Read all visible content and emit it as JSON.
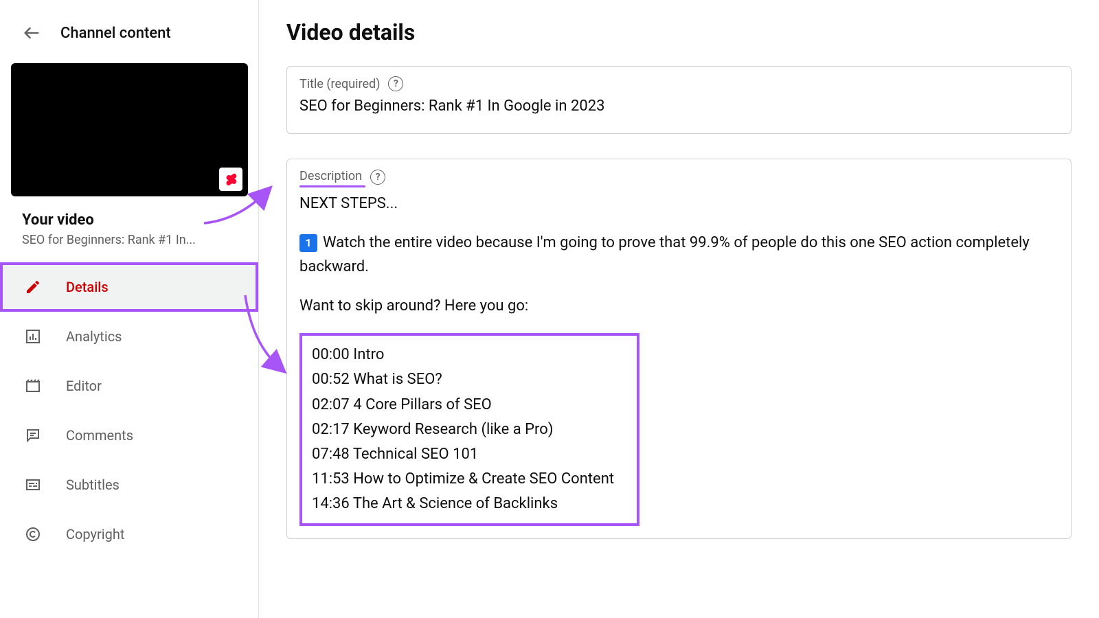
{
  "sidebar": {
    "header_title": "Channel content",
    "your_video_label": "Your video",
    "video_title_truncated": "SEO for Beginners: Rank #1 In...",
    "items": [
      {
        "label": "Details",
        "icon": "pencil-icon"
      },
      {
        "label": "Analytics",
        "icon": "chart-icon"
      },
      {
        "label": "Editor",
        "icon": "film-icon"
      },
      {
        "label": "Comments",
        "icon": "comment-icon"
      },
      {
        "label": "Subtitles",
        "icon": "subtitles-icon"
      },
      {
        "label": "Copyright",
        "icon": "copyright-icon"
      }
    ]
  },
  "main": {
    "page_title": "Video details",
    "title_field": {
      "label": "Title (required)",
      "value": "SEO for Beginners: Rank #1 In Google in 2023"
    },
    "description_field": {
      "label": "Description",
      "line_next_steps": "NEXT STEPS...",
      "line_watch": "Watch the entire video because I'm going to prove that 99.9% of people do this one SEO action completely backward.",
      "line_skip": "Want to skip around? Here you go:",
      "chapters": [
        "00:00 Intro",
        "00:52 What is SEO?",
        "02:07 4 Core Pillars of SEO",
        "02:17 Keyword Research (like a Pro)",
        "07:48 Technical SEO 101",
        "11:53 How to Optimize & Create SEO Content",
        "14:36 The Art & Science of Backlinks"
      ]
    }
  }
}
